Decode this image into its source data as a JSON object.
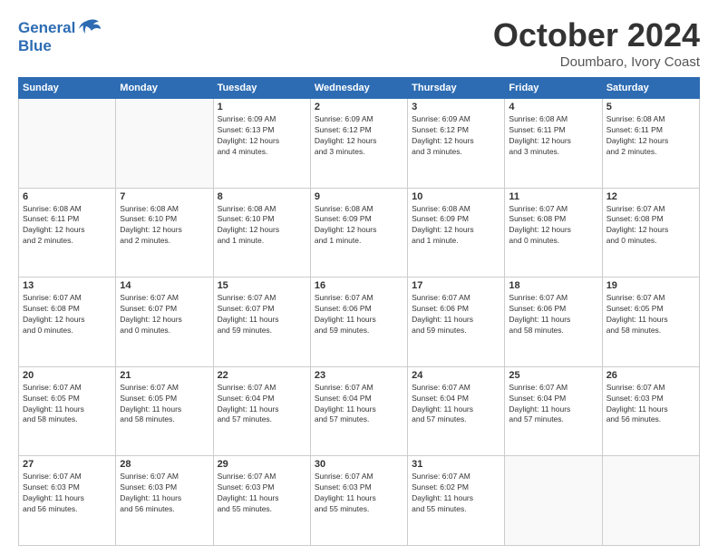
{
  "logo": {
    "line1": "General",
    "line2": "Blue"
  },
  "title": "October 2024",
  "subtitle": "Doumbaro, Ivory Coast",
  "headers": [
    "Sunday",
    "Monday",
    "Tuesday",
    "Wednesday",
    "Thursday",
    "Friday",
    "Saturday"
  ],
  "weeks": [
    [
      {
        "day": "",
        "info": ""
      },
      {
        "day": "",
        "info": ""
      },
      {
        "day": "1",
        "info": "Sunrise: 6:09 AM\nSunset: 6:13 PM\nDaylight: 12 hours\nand 4 minutes."
      },
      {
        "day": "2",
        "info": "Sunrise: 6:09 AM\nSunset: 6:12 PM\nDaylight: 12 hours\nand 3 minutes."
      },
      {
        "day": "3",
        "info": "Sunrise: 6:09 AM\nSunset: 6:12 PM\nDaylight: 12 hours\nand 3 minutes."
      },
      {
        "day": "4",
        "info": "Sunrise: 6:08 AM\nSunset: 6:11 PM\nDaylight: 12 hours\nand 3 minutes."
      },
      {
        "day": "5",
        "info": "Sunrise: 6:08 AM\nSunset: 6:11 PM\nDaylight: 12 hours\nand 2 minutes."
      }
    ],
    [
      {
        "day": "6",
        "info": "Sunrise: 6:08 AM\nSunset: 6:11 PM\nDaylight: 12 hours\nand 2 minutes."
      },
      {
        "day": "7",
        "info": "Sunrise: 6:08 AM\nSunset: 6:10 PM\nDaylight: 12 hours\nand 2 minutes."
      },
      {
        "day": "8",
        "info": "Sunrise: 6:08 AM\nSunset: 6:10 PM\nDaylight: 12 hours\nand 1 minute."
      },
      {
        "day": "9",
        "info": "Sunrise: 6:08 AM\nSunset: 6:09 PM\nDaylight: 12 hours\nand 1 minute."
      },
      {
        "day": "10",
        "info": "Sunrise: 6:08 AM\nSunset: 6:09 PM\nDaylight: 12 hours\nand 1 minute."
      },
      {
        "day": "11",
        "info": "Sunrise: 6:07 AM\nSunset: 6:08 PM\nDaylight: 12 hours\nand 0 minutes."
      },
      {
        "day": "12",
        "info": "Sunrise: 6:07 AM\nSunset: 6:08 PM\nDaylight: 12 hours\nand 0 minutes."
      }
    ],
    [
      {
        "day": "13",
        "info": "Sunrise: 6:07 AM\nSunset: 6:08 PM\nDaylight: 12 hours\nand 0 minutes."
      },
      {
        "day": "14",
        "info": "Sunrise: 6:07 AM\nSunset: 6:07 PM\nDaylight: 12 hours\nand 0 minutes."
      },
      {
        "day": "15",
        "info": "Sunrise: 6:07 AM\nSunset: 6:07 PM\nDaylight: 11 hours\nand 59 minutes."
      },
      {
        "day": "16",
        "info": "Sunrise: 6:07 AM\nSunset: 6:06 PM\nDaylight: 11 hours\nand 59 minutes."
      },
      {
        "day": "17",
        "info": "Sunrise: 6:07 AM\nSunset: 6:06 PM\nDaylight: 11 hours\nand 59 minutes."
      },
      {
        "day": "18",
        "info": "Sunrise: 6:07 AM\nSunset: 6:06 PM\nDaylight: 11 hours\nand 58 minutes."
      },
      {
        "day": "19",
        "info": "Sunrise: 6:07 AM\nSunset: 6:05 PM\nDaylight: 11 hours\nand 58 minutes."
      }
    ],
    [
      {
        "day": "20",
        "info": "Sunrise: 6:07 AM\nSunset: 6:05 PM\nDaylight: 11 hours\nand 58 minutes."
      },
      {
        "day": "21",
        "info": "Sunrise: 6:07 AM\nSunset: 6:05 PM\nDaylight: 11 hours\nand 58 minutes."
      },
      {
        "day": "22",
        "info": "Sunrise: 6:07 AM\nSunset: 6:04 PM\nDaylight: 11 hours\nand 57 minutes."
      },
      {
        "day": "23",
        "info": "Sunrise: 6:07 AM\nSunset: 6:04 PM\nDaylight: 11 hours\nand 57 minutes."
      },
      {
        "day": "24",
        "info": "Sunrise: 6:07 AM\nSunset: 6:04 PM\nDaylight: 11 hours\nand 57 minutes."
      },
      {
        "day": "25",
        "info": "Sunrise: 6:07 AM\nSunset: 6:04 PM\nDaylight: 11 hours\nand 57 minutes."
      },
      {
        "day": "26",
        "info": "Sunrise: 6:07 AM\nSunset: 6:03 PM\nDaylight: 11 hours\nand 56 minutes."
      }
    ],
    [
      {
        "day": "27",
        "info": "Sunrise: 6:07 AM\nSunset: 6:03 PM\nDaylight: 11 hours\nand 56 minutes."
      },
      {
        "day": "28",
        "info": "Sunrise: 6:07 AM\nSunset: 6:03 PM\nDaylight: 11 hours\nand 56 minutes."
      },
      {
        "day": "29",
        "info": "Sunrise: 6:07 AM\nSunset: 6:03 PM\nDaylight: 11 hours\nand 55 minutes."
      },
      {
        "day": "30",
        "info": "Sunrise: 6:07 AM\nSunset: 6:03 PM\nDaylight: 11 hours\nand 55 minutes."
      },
      {
        "day": "31",
        "info": "Sunrise: 6:07 AM\nSunset: 6:02 PM\nDaylight: 11 hours\nand 55 minutes."
      },
      {
        "day": "",
        "info": ""
      },
      {
        "day": "",
        "info": ""
      }
    ]
  ]
}
